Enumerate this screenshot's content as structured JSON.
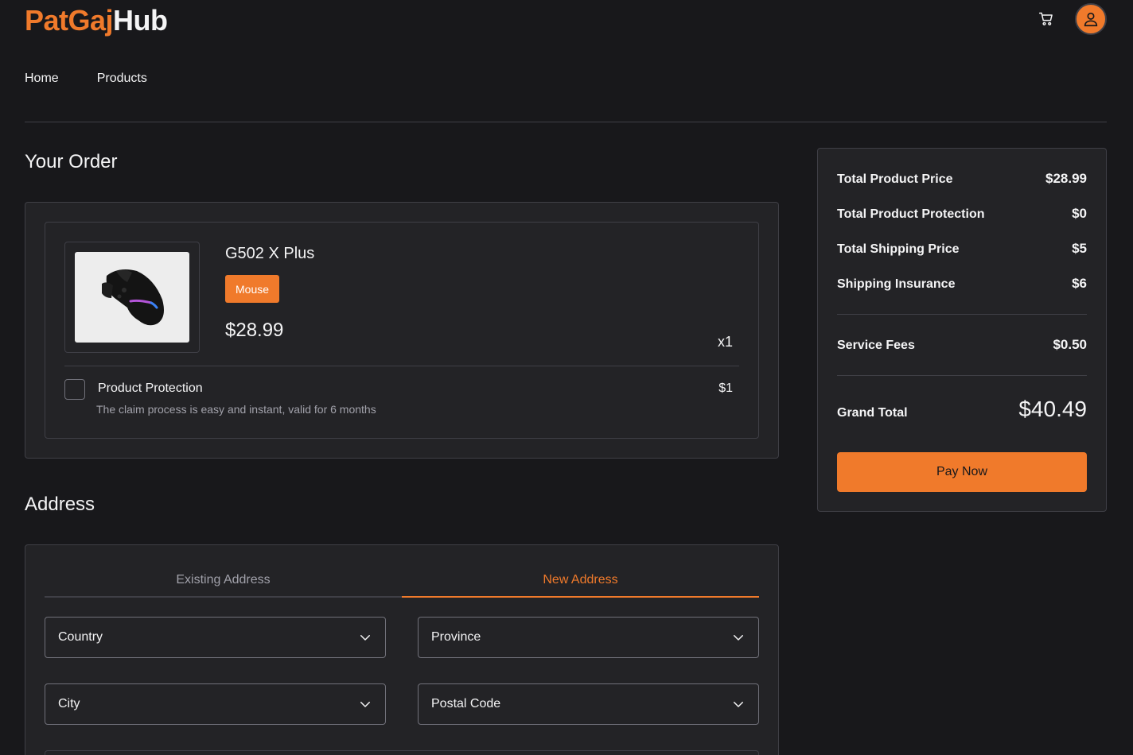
{
  "header": {
    "logo_part1": "PatGaj",
    "logo_part2": "Hub",
    "cart_icon": "cart-icon",
    "avatar_icon": "user-icon"
  },
  "nav": {
    "items": [
      {
        "label": "Home"
      },
      {
        "label": "Products"
      }
    ]
  },
  "order": {
    "title": "Your Order",
    "item": {
      "name": "G502 X Plus",
      "category": "Mouse",
      "price": "$28.99",
      "quantity": "x1",
      "image": "gaming-mouse-image"
    },
    "protection": {
      "title": "Product Protection",
      "description": "The claim process is easy and instant, valid for 6 months",
      "price": "$1",
      "checked": false
    }
  },
  "summary": {
    "rows": [
      {
        "label": "Total Product Price",
        "value": "$28.99"
      },
      {
        "label": "Total Product Protection",
        "value": "$0"
      },
      {
        "label": "Total Shipping Price",
        "value": "$5"
      },
      {
        "label": "Shipping Insurance",
        "value": "$6"
      }
    ],
    "service_fees": {
      "label": "Service Fees",
      "value": "$0.50"
    },
    "grand_total": {
      "label": "Grand Total",
      "value": "$40.49"
    },
    "pay_label": "Pay Now"
  },
  "address": {
    "title": "Address",
    "tabs": [
      {
        "label": "Existing Address",
        "active": false
      },
      {
        "label": "New Address",
        "active": true
      }
    ],
    "fields": {
      "country": "Country",
      "province": "Province",
      "city": "City",
      "postal_code": "Postal Code"
    }
  },
  "colors": {
    "accent": "#f07a2b",
    "background": "#18181b",
    "card": "#232326",
    "border": "#3f3f46"
  }
}
